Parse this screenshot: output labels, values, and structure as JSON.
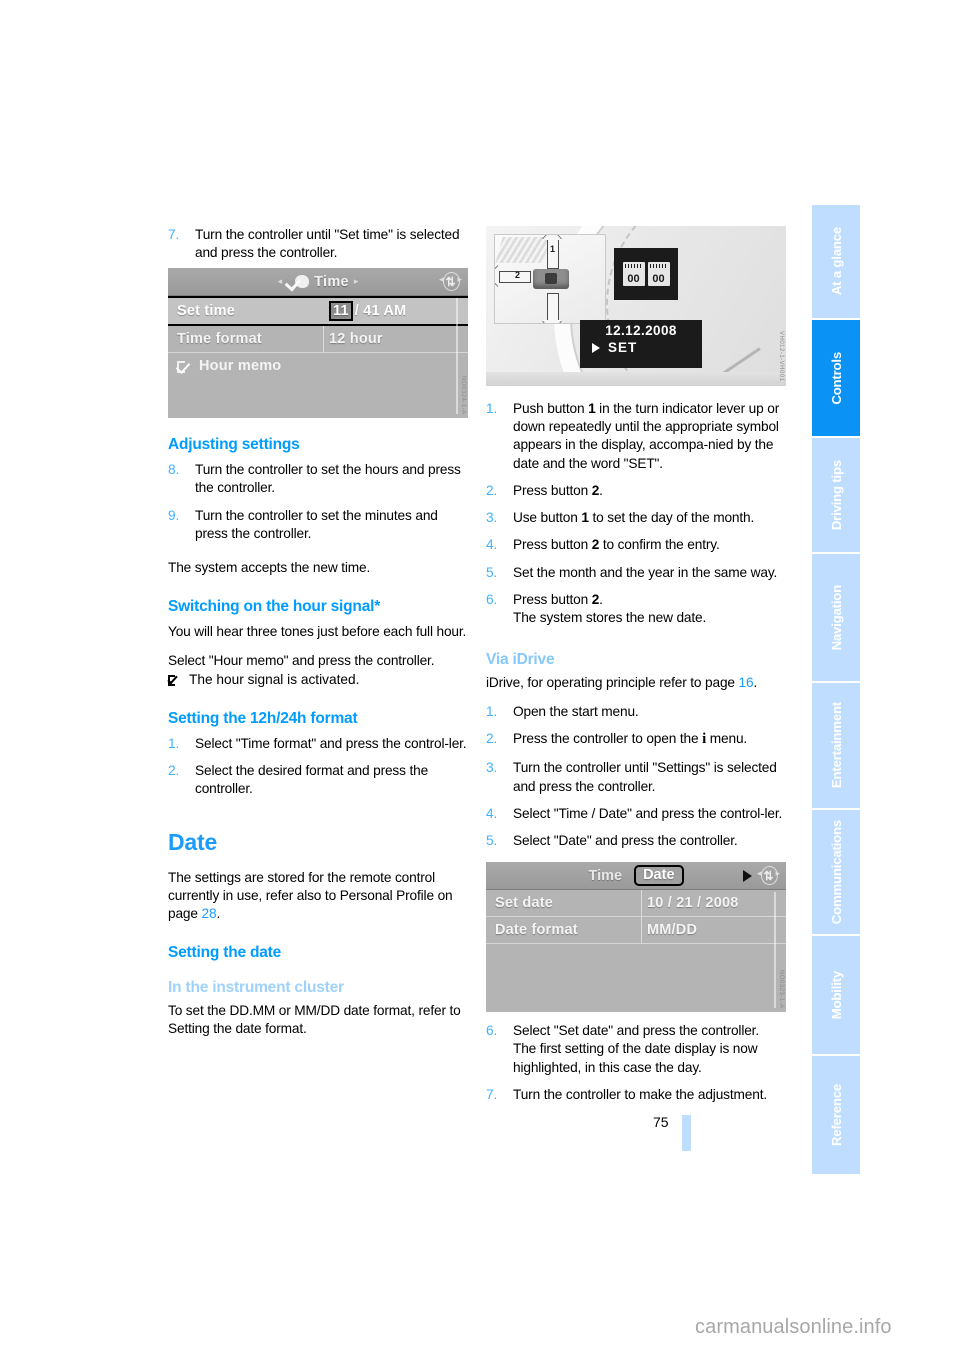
{
  "document": {
    "page_number": "75",
    "watermark": "carmanualsonline.info"
  },
  "colors": {
    "accent_blue": "#009cff",
    "light_blue": "#bfdeff",
    "active_tab": "#0a93f5",
    "pale_heading": "#9fd2fb"
  },
  "sidebar": {
    "tabs": [
      {
        "label": "At a glance",
        "active": false
      },
      {
        "label": "Controls",
        "active": true
      },
      {
        "label": "Driving tips",
        "active": false
      },
      {
        "label": "Navigation",
        "active": false
      },
      {
        "label": "Entertainment",
        "active": false
      },
      {
        "label": "Communications",
        "active": false
      },
      {
        "label": "Mobility",
        "active": false
      },
      {
        "label": "Reference",
        "active": false
      }
    ]
  },
  "left_column": {
    "step7": {
      "num": "7.",
      "text": "Turn the controller until \"Set time\" is selected and press the controller."
    },
    "time_screen": {
      "title": "Time",
      "arrow_left": "◂",
      "arrow_right": "▸",
      "rows": [
        {
          "label": "Set time",
          "value_highlight": "11",
          "value_rest": "/ 41 AM",
          "selected": true
        },
        {
          "label": "Time format",
          "value": "12 hour",
          "selected": false
        },
        {
          "label": "Hour memo",
          "value": "",
          "checkbox": true,
          "selected": false
        }
      ],
      "image_code": "NO0324-1-A"
    },
    "adjusting_heading": "Adjusting settings",
    "adjust_steps": [
      {
        "num": "8.",
        "text": "Turn the controller to set the hours and press the controller."
      },
      {
        "num": "9.",
        "text": "Turn the controller to set the minutes and press the controller."
      }
    ],
    "accepts_text": "The system accepts the new time.",
    "hour_signal_heading": "Switching on the hour signal*",
    "hour_signal_p1": "You will hear three tones just before each full hour.",
    "hour_signal_p2": "Select \"Hour memo\" and press the controller.",
    "hour_signal_p3": "The hour signal is activated.",
    "format_heading": "Setting the 12h/24h format",
    "format_steps": [
      {
        "num": "1.",
        "text": "Select \"Time format\" and press the control-ler."
      },
      {
        "num": "2.",
        "text": "Select the desired format and press the controller."
      }
    ],
    "date_heading": "Date",
    "date_p1_a": "The settings are stored for the remote control currently in use, refer also to Personal Profile on page ",
    "date_p1_ref": "28",
    "date_p1_b": ".",
    "setting_date_heading": "Setting the date",
    "instrument_cluster_heading": "In the instrument cluster",
    "instrument_cluster_text": "To set the DD.MM or MM/DD date format, refer to Setting the date format."
  },
  "right_column": {
    "cluster_photo": {
      "label_1": "1",
      "label_2": "2",
      "calendar_left": "00",
      "calendar_right": "00",
      "date_line": "12.12.2008",
      "set_line": "SET",
      "image_code": "VH012-1-VH001"
    },
    "cluster_steps": [
      {
        "num": "1.",
        "parts": [
          {
            "t": "Push button "
          },
          {
            "t": "1",
            "b": true
          },
          {
            "t": " in the turn indicator lever up or down repeatedly until the appropriate symbol appears in the display, accompa-nied by the date and the word \"SET\"."
          }
        ]
      },
      {
        "num": "2.",
        "parts": [
          {
            "t": "Press button "
          },
          {
            "t": "2",
            "b": true
          },
          {
            "t": "."
          }
        ]
      },
      {
        "num": "3.",
        "parts": [
          {
            "t": "Use button "
          },
          {
            "t": "1",
            "b": true
          },
          {
            "t": " to set the day of the month."
          }
        ]
      },
      {
        "num": "4.",
        "parts": [
          {
            "t": "Press button "
          },
          {
            "t": "2",
            "b": true
          },
          {
            "t": " to confirm the entry."
          }
        ]
      },
      {
        "num": "5.",
        "parts": [
          {
            "t": "Set the month and the year in the same way."
          }
        ]
      },
      {
        "num": "6.",
        "parts": [
          {
            "t": "Press button "
          },
          {
            "t": "2",
            "b": true
          },
          {
            "t": ".\nThe system stores the new date."
          }
        ]
      }
    ],
    "via_idrive_heading": "Via iDrive",
    "via_idrive_intro_a": "iDrive, for operating principle refer to page ",
    "via_idrive_intro_ref": "16",
    "via_idrive_intro_b": ".",
    "idrive_steps": [
      {
        "num": "1.",
        "text": "Open the start menu."
      },
      {
        "num": "2.",
        "text_before": "Press the controller to open the ",
        "glyph": "i",
        "text_after": " menu."
      },
      {
        "num": "3.",
        "text": "Turn the controller until \"Settings\" is selected and press the controller."
      },
      {
        "num": "4.",
        "text": "Select \"Time / Date\" and press the control-ler."
      },
      {
        "num": "5.",
        "text": "Select \"Date\" and press the controller."
      }
    ],
    "date_screen": {
      "tab_inactive": "Time",
      "tab_active": "Date",
      "rows": [
        {
          "label": "Set date",
          "value": "10 / 21 / 2008"
        },
        {
          "label": "Date format",
          "value": "MM/DD"
        }
      ],
      "image_code": "NO0323-1-A"
    },
    "final_steps": [
      {
        "num": "6.",
        "text": "Select \"Set date\" and press the controller.\nThe first setting of the date display is now highlighted, in this case the day."
      },
      {
        "num": "7.",
        "text": "Turn the controller to make the adjustment."
      }
    ]
  }
}
